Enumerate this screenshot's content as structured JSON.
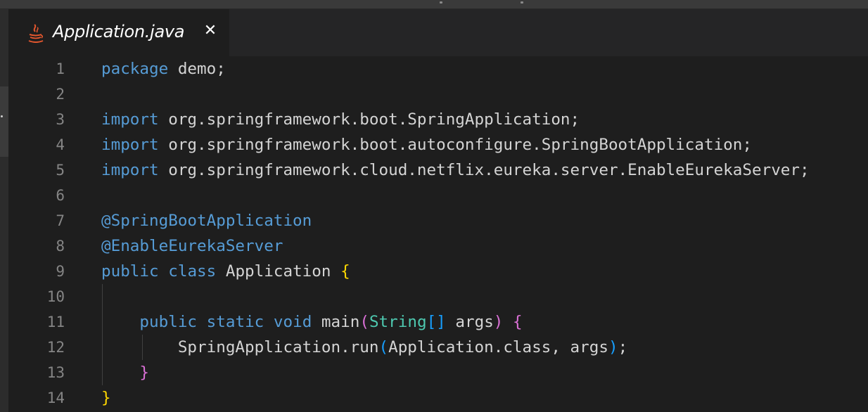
{
  "tab": {
    "filename": "Application.java",
    "close_glyph": "✕",
    "icon": "java-icon"
  },
  "lines": [
    {
      "number": "1",
      "tokens": [
        {
          "t": "package",
          "c": "kw"
        },
        {
          "t": " demo;",
          "c": "plain"
        }
      ]
    },
    {
      "number": "2",
      "tokens": []
    },
    {
      "number": "3",
      "tokens": [
        {
          "t": "import",
          "c": "kw"
        },
        {
          "t": " org.springframework.boot.SpringApplication;",
          "c": "plain"
        }
      ]
    },
    {
      "number": "4",
      "tokens": [
        {
          "t": "import",
          "c": "kw"
        },
        {
          "t": " org.springframework.boot.autoconfigure.SpringBootApplication;",
          "c": "plain"
        }
      ]
    },
    {
      "number": "5",
      "tokens": [
        {
          "t": "import",
          "c": "kw"
        },
        {
          "t": " org.springframework.cloud.netflix.eureka.server.EnableEurekaServer;",
          "c": "plain"
        }
      ]
    },
    {
      "number": "6",
      "tokens": []
    },
    {
      "number": "7",
      "tokens": [
        {
          "t": "@SpringBootApplication",
          "c": "ann"
        }
      ]
    },
    {
      "number": "8",
      "tokens": [
        {
          "t": "@EnableEurekaServer",
          "c": "ann"
        }
      ]
    },
    {
      "number": "9",
      "tokens": [
        {
          "t": "public",
          "c": "kw"
        },
        {
          "t": " ",
          "c": "plain"
        },
        {
          "t": "class",
          "c": "kw"
        },
        {
          "t": " Application ",
          "c": "plain"
        },
        {
          "t": "{",
          "c": "brace-y"
        }
      ]
    },
    {
      "number": "10",
      "tokens": []
    },
    {
      "number": "11",
      "tokens": [
        {
          "t": "    ",
          "c": "plain"
        },
        {
          "t": "public",
          "c": "kw"
        },
        {
          "t": " ",
          "c": "plain"
        },
        {
          "t": "static",
          "c": "kw"
        },
        {
          "t": " ",
          "c": "plain"
        },
        {
          "t": "void",
          "c": "kw"
        },
        {
          "t": " main",
          "c": "plain"
        },
        {
          "t": "(",
          "c": "brace-p"
        },
        {
          "t": "String",
          "c": "type"
        },
        {
          "t": "[]",
          "c": "brace-b"
        },
        {
          "t": " args",
          "c": "plain"
        },
        {
          "t": ")",
          "c": "brace-p"
        },
        {
          "t": " ",
          "c": "plain"
        },
        {
          "t": "{",
          "c": "brace-p"
        }
      ]
    },
    {
      "number": "12",
      "tokens": [
        {
          "t": "        SpringApplication.run",
          "c": "plain"
        },
        {
          "t": "(",
          "c": "brace-b"
        },
        {
          "t": "Application.class, args",
          "c": "plain"
        },
        {
          "t": ")",
          "c": "brace-b"
        },
        {
          "t": ";",
          "c": "plain"
        }
      ]
    },
    {
      "number": "13",
      "tokens": [
        {
          "t": "    ",
          "c": "plain"
        },
        {
          "t": "}",
          "c": "brace-p"
        }
      ]
    },
    {
      "number": "14",
      "tokens": [
        {
          "t": "}",
          "c": "brace-y"
        }
      ]
    }
  ],
  "colors": {
    "background": "#1e1e1e",
    "keyword": "#569cd6",
    "type": "#4ec9b0",
    "brace_level1": "#ffd700",
    "brace_level2": "#da70d6",
    "brace_level3": "#179fff",
    "line_number": "#858585"
  }
}
